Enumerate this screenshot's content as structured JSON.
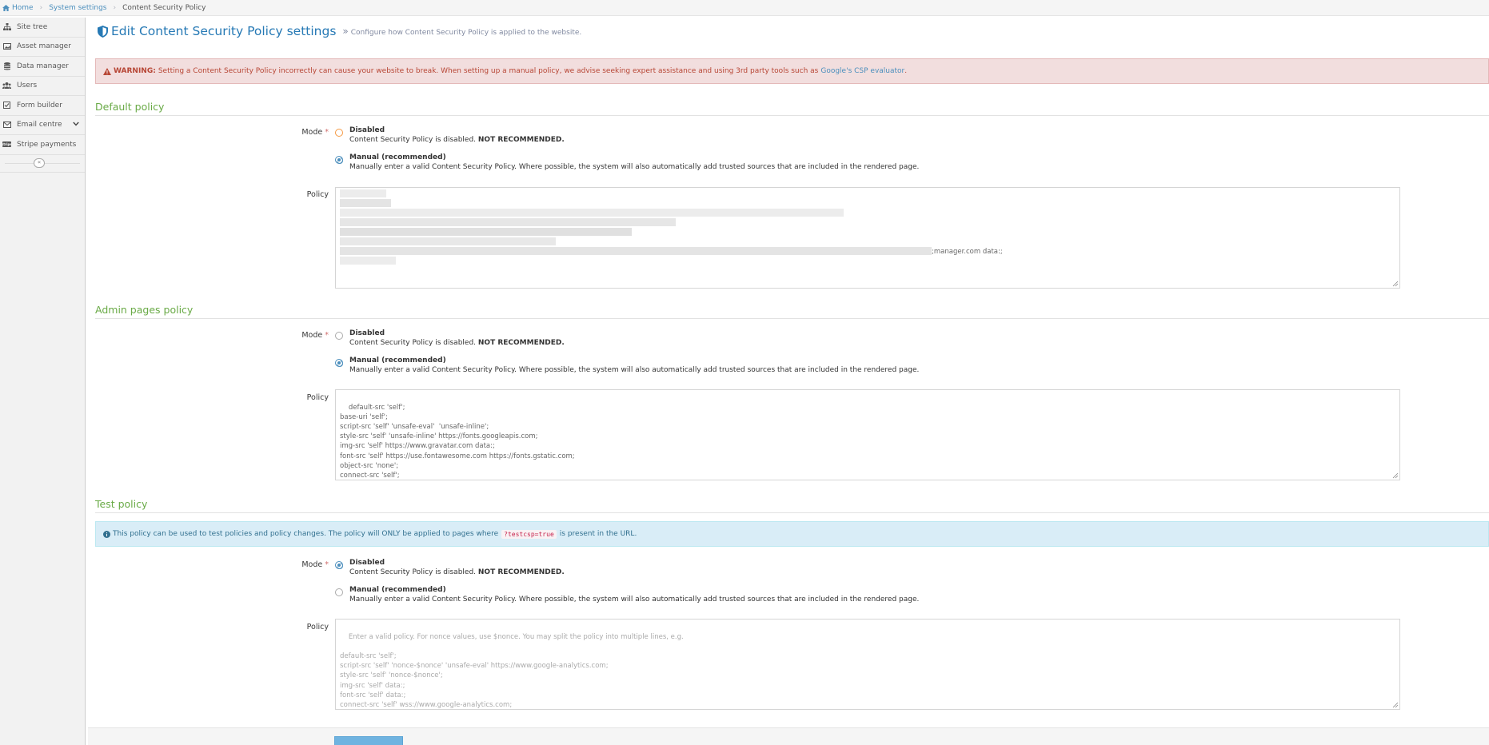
{
  "breadcrumb": {
    "home": "Home",
    "system_settings": "System settings",
    "current": "Content Security Policy"
  },
  "sidebar": {
    "items": [
      {
        "label": "Site tree",
        "icon": "sitemap-icon"
      },
      {
        "label": "Asset manager",
        "icon": "image-icon"
      },
      {
        "label": "Data manager",
        "icon": "database-icon"
      },
      {
        "label": "Users",
        "icon": "users-icon"
      },
      {
        "label": "Form builder",
        "icon": "checkbox-icon"
      },
      {
        "label": "Email centre",
        "icon": "envelope-icon"
      },
      {
        "label": "Stripe payments",
        "icon": "stripe-icon"
      }
    ],
    "collapse_glyph": "«"
  },
  "header": {
    "title": "Edit Content Security Policy settings",
    "subtitle": "Configure how Content Security Policy is applied to the website."
  },
  "warning": {
    "label": "WARNING:",
    "text": "Setting a Content Security Policy incorrectly can cause your website to break. When setting up a manual policy, we advise seeking expert assistance and using 3rd party tools such as",
    "link": "Google's CSP evaluator",
    "end": "."
  },
  "sections": {
    "default": {
      "title": "Default policy",
      "mode_label": "Mode",
      "required_mark": "*",
      "policy_label": "Policy",
      "disabled_title": "Disabled",
      "disabled_desc": "Content Security Policy is disabled.",
      "disabled_strong": "NOT RECOMMENDED.",
      "manual_title": "Manual (recommended)",
      "manual_desc": "Manually enter a valid Content Security Policy. Where possible, the system will also automatically add trusted sources that are included in the rendered page.",
      "policy_visible_fragment": ";manager.com data:;"
    },
    "admin": {
      "title": "Admin pages policy",
      "mode_label": "Mode",
      "required_mark": "*",
      "policy_label": "Policy",
      "disabled_title": "Disabled",
      "disabled_desc": "Content Security Policy is disabled.",
      "disabled_strong": "NOT RECOMMENDED.",
      "manual_title": "Manual (recommended)",
      "manual_desc": "Manually enter a valid Content Security Policy. Where possible, the system will also automatically add trusted sources that are included in the rendered page.",
      "policy": "default-src 'self';\nbase-uri 'self';\nscript-src 'self' 'unsafe-eval'  'unsafe-inline';\nstyle-src 'self' 'unsafe-inline' https://fonts.googleapis.com;\nimg-src 'self' https://www.gravatar.com data:;\nfont-src 'self' https://use.fontawesome.com https://fonts.gstatic.com;\nobject-src 'none';\nconnect-src 'self';"
    },
    "test": {
      "title": "Test policy",
      "info_before": "This policy can be used to test policies and policy changes. The policy will ONLY be applied to pages where",
      "info_code": "?testcsp=true",
      "info_after": "is present in the URL.",
      "mode_label": "Mode",
      "required_mark": "*",
      "policy_label": "Policy",
      "disabled_title": "Disabled",
      "disabled_desc": "Content Security Policy is disabled.",
      "disabled_strong": "NOT RECOMMENDED.",
      "manual_title": "Manual (recommended)",
      "manual_desc": "Manually enter a valid Content Security Policy. Where possible, the system will also automatically add trusted sources that are included in the rendered page.",
      "placeholder": "Enter a valid policy. For nonce values, use $nonce. You may split the policy into multiple lines, e.g.\n\ndefault-src 'self';\nscript-src 'self' 'nonce-$nonce' 'unsafe-eval' https://www.google-analytics.com;\nstyle-src 'self' 'nonce-$nonce';\nimg-src 'self' data:;\nfont-src 'self' data:;\nconnect-src 'self' wss://www.google-analytics.com;"
    }
  },
  "selected": {
    "default": "manual",
    "admin": "manual",
    "test": "disabled"
  },
  "colors": {
    "link": "#4c8fbd",
    "section_title": "#69aa46",
    "danger_bg": "#f2dede",
    "info_bg": "#d9edf7",
    "primary_button": "#6fb3e0"
  }
}
